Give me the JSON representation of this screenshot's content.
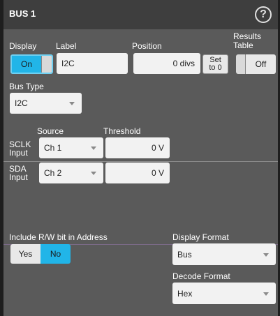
{
  "window": {
    "title": "BUS 1",
    "help_glyph": "?"
  },
  "display": {
    "label": "Display",
    "on_label": "On"
  },
  "label_field": {
    "label": "Label",
    "value": "I2C"
  },
  "position": {
    "label": "Position",
    "value": "0 divs",
    "set_to_zero_line1": "Set",
    "set_to_zero_line2": "to 0"
  },
  "results_table": {
    "label_line1": "Results",
    "label_line2": "Table",
    "off_label": "Off"
  },
  "bus_type": {
    "label": "Bus Type",
    "value": "I2C"
  },
  "columns": {
    "source": "Source",
    "threshold": "Threshold"
  },
  "sclk": {
    "label_line1": "SCLK",
    "label_line2": "Input",
    "source": "Ch 1",
    "threshold": "0 V"
  },
  "sda": {
    "label_line1": "SDA",
    "label_line2": "Input",
    "source": "Ch 2",
    "threshold": "0 V"
  },
  "rw_bit": {
    "label": "Include R/W bit in Address",
    "yes_label": "Yes",
    "no_label": "No"
  },
  "display_format": {
    "label": "Display Format",
    "value": "Bus"
  },
  "decode_format": {
    "label": "Decode Format",
    "value": "Hex"
  },
  "colors": {
    "accent": "#21b5e8",
    "panel": "#5a5a5a",
    "titlebar": "#3e3e3e",
    "field": "#f2f2f2"
  }
}
